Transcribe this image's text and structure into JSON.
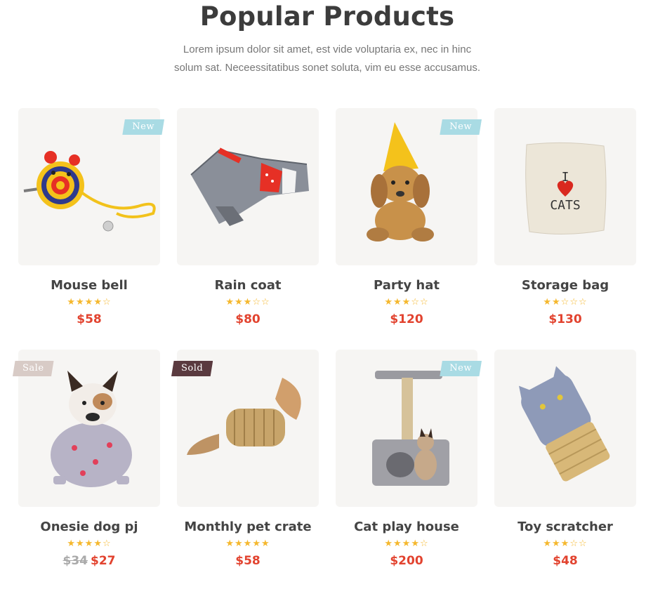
{
  "section": {
    "title": "Popular Products",
    "subtitle_line1": "Lorem ipsum dolor sit amet, est vide voluptaria ex, nec in hinc",
    "subtitle_line2": "solum sat. Neceessitatibus sonet soluta, vim eu esse accusamus."
  },
  "colors": {
    "accent_price": "#e2432f",
    "star": "#f5b82e",
    "badge_new": "#a9dbe4",
    "badge_sale": "#d8cbc6",
    "badge_sold": "#5a3a3f"
  },
  "products": [
    {
      "name": "Mouse bell",
      "rating": 4,
      "price": "$58",
      "old_price": "",
      "badge": "New",
      "badge_type": "new",
      "image": "mouse-bell-toy-image"
    },
    {
      "name": "Rain coat",
      "rating": 3,
      "price": "$80",
      "old_price": "",
      "badge": "",
      "badge_type": "",
      "image": "rain-coat-image"
    },
    {
      "name": "Party hat",
      "rating": 3,
      "price": "$120",
      "old_price": "",
      "badge": "New",
      "badge_type": "new",
      "image": "party-hat-dog-image"
    },
    {
      "name": "Storage bag",
      "rating": 2,
      "price": "$130",
      "old_price": "",
      "badge": "",
      "badge_type": "",
      "image": "storage-bag-image"
    },
    {
      "name": "Onesie dog pj",
      "rating": 4,
      "price": "$27",
      "old_price": "$34",
      "badge": "Sale",
      "badge_type": "sale",
      "image": "dog-pajamas-image"
    },
    {
      "name": "Monthly pet crate",
      "rating": 5,
      "price": "$58",
      "old_price": "",
      "badge": "Sold",
      "badge_type": "sold",
      "image": "feather-toy-image"
    },
    {
      "name": "Cat play house",
      "rating": 4,
      "price": "$200",
      "old_price": "",
      "badge": "New",
      "badge_type": "new",
      "image": "cat-tree-image"
    },
    {
      "name": "Toy scratcher",
      "rating": 3,
      "price": "$48",
      "old_price": "",
      "badge": "",
      "badge_type": "",
      "image": "cat-scratcher-toy-image"
    }
  ]
}
